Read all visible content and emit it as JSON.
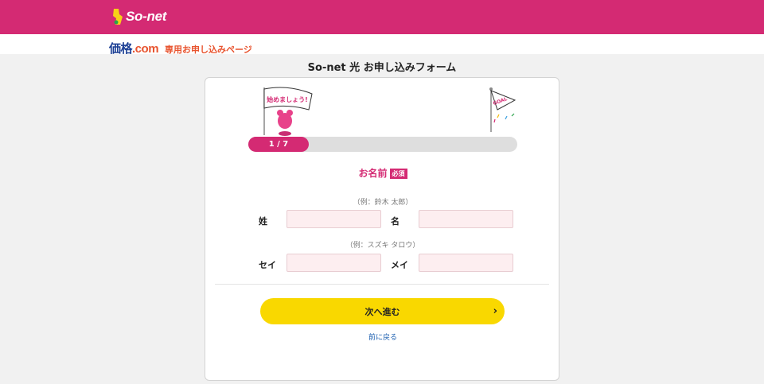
{
  "header": {
    "brand_text": "So-net",
    "brand_color": "#d42a73"
  },
  "subheader": {
    "partner_logo": "価格",
    "partner_logo_suffix": ".com",
    "partner_text": "専用お申し込みページ"
  },
  "page_title": "So-net 光 お申し込みフォーム",
  "progress": {
    "label": "1 / 7",
    "current": 1,
    "total": 7,
    "start_flag_text": "始めましょう!",
    "goal_flag_text": "GOAL"
  },
  "section": {
    "title": "お名前",
    "required_badge": "必須"
  },
  "name_fields": {
    "hint": "（例：鈴木 太郎）",
    "last_label": "姓",
    "first_label": "名",
    "last_value": "",
    "first_value": ""
  },
  "kana_fields": {
    "hint": "（例：スズキ タロウ）",
    "last_label": "セイ",
    "first_label": "メイ",
    "last_value": "",
    "first_value": ""
  },
  "actions": {
    "next_label": "次へ進む",
    "next_chevron": "›",
    "back_label": "前に戻る"
  },
  "colors": {
    "accent": "#d42a73",
    "button": "#f9d800",
    "input_bg": "#fdeef0"
  }
}
